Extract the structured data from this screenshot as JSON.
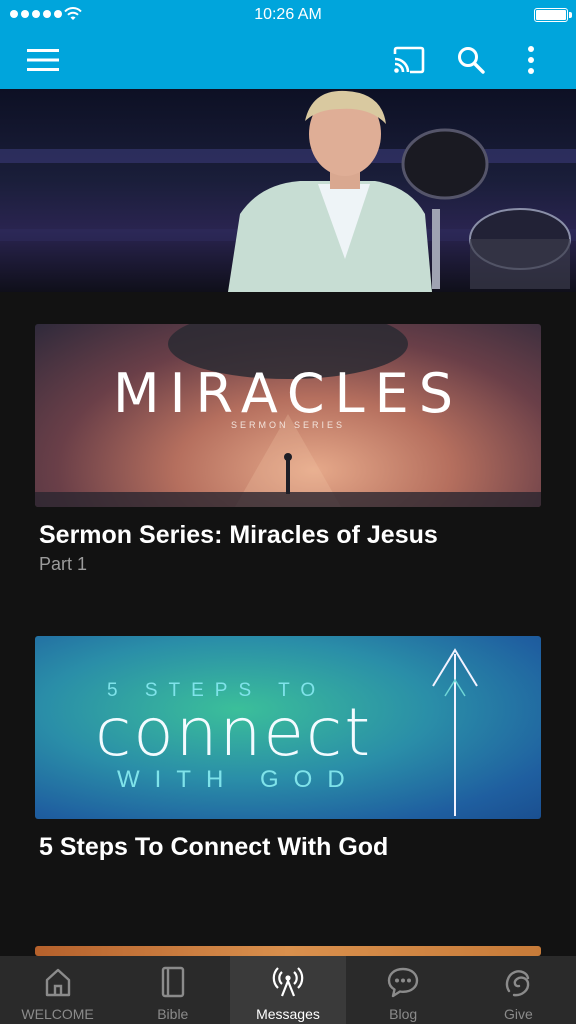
{
  "status_bar": {
    "time": "10:26 AM"
  },
  "app_bar": {
    "menu_icon": "hamburger-menu-icon",
    "cast_icon": "cast-icon",
    "search_icon": "search-icon",
    "more_icon": "more-vertical-icon",
    "color": "#00a5dc"
  },
  "hero": {
    "image": "pastor speaking on stage"
  },
  "messages": [
    {
      "title": "Sermon Series:  Miracles of Jesus",
      "subtitle": "Part 1",
      "artwork": {
        "headline": "MIRACLES",
        "tagline": "SERMON SERIES"
      }
    },
    {
      "title": "5 Steps To Connect With God",
      "artwork": {
        "line1": "5 STEPS TO",
        "line2": "connect",
        "line3": "WITH GOD"
      }
    }
  ],
  "tabs": [
    {
      "label": "WELCOME",
      "icon": "home-icon",
      "active": false
    },
    {
      "label": "Bible",
      "icon": "book-icon",
      "active": false
    },
    {
      "label": "Messages",
      "icon": "broadcast-icon",
      "active": true
    },
    {
      "label": "Blog",
      "icon": "chat-bubble-icon",
      "active": false
    },
    {
      "label": "Give",
      "icon": "give-icon",
      "active": false
    }
  ]
}
